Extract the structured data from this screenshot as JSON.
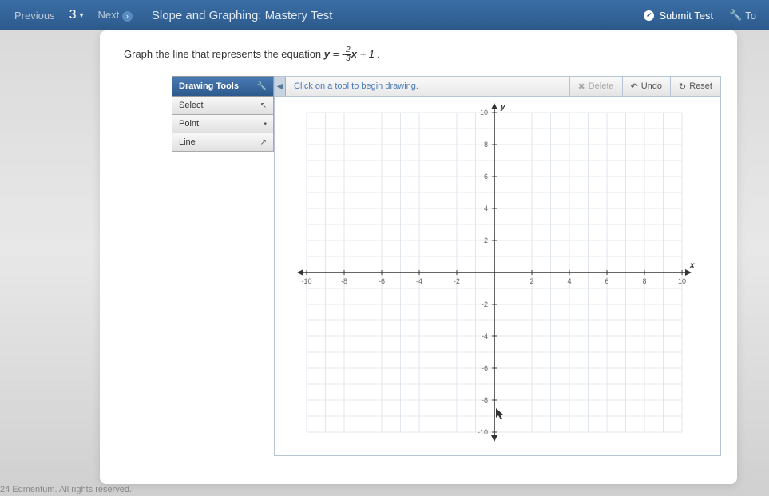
{
  "header": {
    "previous": "Previous",
    "question_number": "3",
    "next": "Next",
    "title": "Slope and Graphing: Mastery Test",
    "submit": "Submit Test",
    "tools": "To"
  },
  "question": {
    "prefix": "Graph the line that represents the equation ",
    "var_y": "y",
    "equals": " = -",
    "frac_num": "2",
    "frac_den": "3",
    "var_x": "x",
    "suffix": " + 1 ."
  },
  "tools": {
    "header": "Drawing Tools",
    "items": [
      "Select",
      "Point",
      "Line"
    ]
  },
  "instructions": {
    "text": "Click on a tool to begin drawing.",
    "delete": "Delete",
    "undo": "Undo",
    "reset": "Reset"
  },
  "chart_data": {
    "type": "scatter",
    "title": "",
    "xlabel": "x",
    "ylabel": "y",
    "xlim": [
      -10,
      10
    ],
    "ylim": [
      -10,
      10
    ],
    "x_ticks": [
      -10,
      -8,
      -6,
      -4,
      -2,
      2,
      4,
      6,
      8,
      10
    ],
    "y_ticks": [
      -10,
      -8,
      -6,
      -4,
      -2,
      2,
      4,
      6,
      8,
      10
    ],
    "series": []
  },
  "footer": "24 Edmentum. All rights reserved."
}
